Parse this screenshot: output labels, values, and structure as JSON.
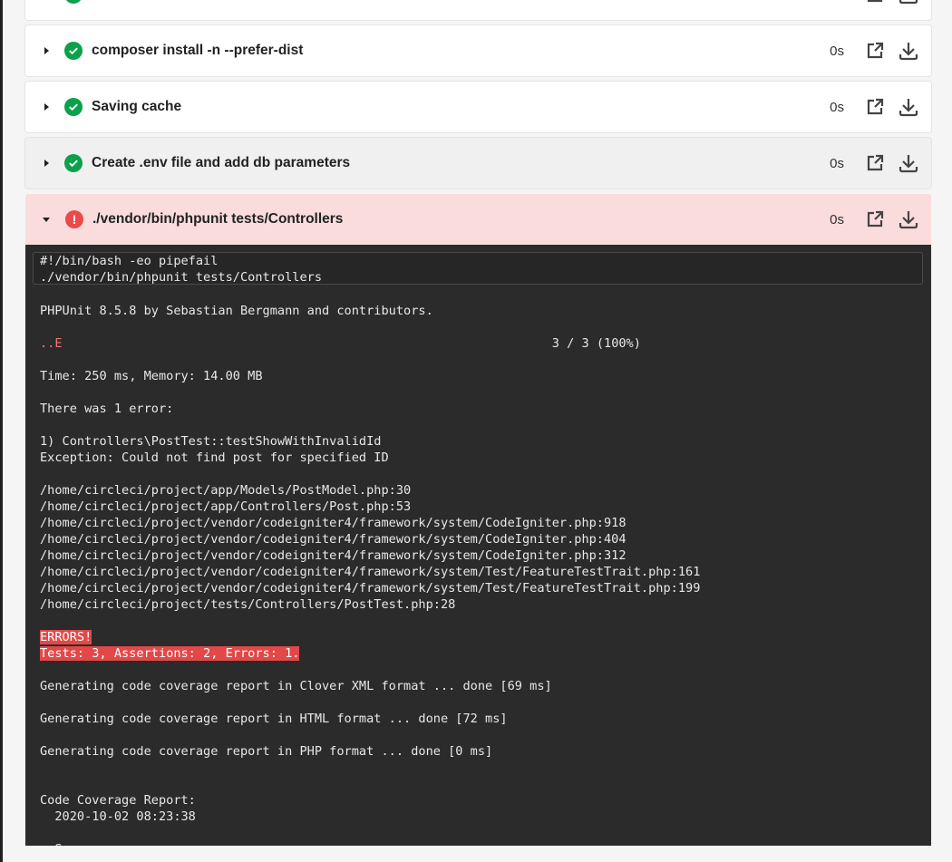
{
  "steps": [
    {
      "title": "",
      "duration": "",
      "status": "success"
    },
    {
      "title": "composer install -n --prefer-dist",
      "duration": "0s",
      "status": "success"
    },
    {
      "title": "Saving cache",
      "duration": "0s",
      "status": "success"
    },
    {
      "title": "Create .env file and add db parameters",
      "duration": "0s",
      "status": "success"
    },
    {
      "title": "./vendor/bin/phpunit tests/Controllers",
      "duration": "0s",
      "status": "failed",
      "expanded": true
    }
  ],
  "colors": {
    "success": "#0ba14a",
    "error": "#ea4a4a",
    "failed_row": "#fbdcdc",
    "terminal": "#2b2b2b"
  },
  "icons": {
    "open": "external-link-icon",
    "download": "download-icon",
    "success": "check-circle-icon",
    "error": "exclamation-circle-icon"
  },
  "terminal": {
    "command": [
      "#!/bin/bash -eo pipefail",
      "./vendor/bin/phpunit tests/Controllers"
    ],
    "header": "PHPUnit 8.5.8 by Sebastian Bergmann and contributors.",
    "progress_dots": "..E",
    "progress_count": "3 / 3 (100%)",
    "lines_a": [
      "",
      "Time: 250 ms, Memory: 14.00 MB",
      "",
      "There was 1 error:",
      "",
      "1) Controllers\\PostTest::testShowWithInvalidId",
      "Exception: Could not find post for specified ID",
      "",
      "/home/circleci/project/app/Models/PostModel.php:30",
      "/home/circleci/project/app/Controllers/Post.php:53",
      "/home/circleci/project/vendor/codeigniter4/framework/system/CodeIgniter.php:918",
      "/home/circleci/project/vendor/codeigniter4/framework/system/CodeIgniter.php:404",
      "/home/circleci/project/vendor/codeigniter4/framework/system/CodeIgniter.php:312",
      "/home/circleci/project/vendor/codeigniter4/framework/system/Test/FeatureTestTrait.php:161",
      "/home/circleci/project/vendor/codeigniter4/framework/system/Test/FeatureTestTrait.php:199",
      "/home/circleci/project/tests/Controllers/PostTest.php:28",
      ""
    ],
    "errors": [
      "ERRORS!",
      "Tests: 3, Assertions: 2, Errors: 1."
    ],
    "lines_b": [
      "",
      "Generating code coverage report in Clover XML format ... done [69 ms]",
      "",
      "Generating code coverage report in HTML format ... done [72 ms]",
      "",
      "Generating code coverage report in PHP format ... done [0 ms]",
      "",
      "",
      "Code Coverage Report:",
      "  2020-10-02 08:23:38",
      "",
      "  S"
    ]
  }
}
